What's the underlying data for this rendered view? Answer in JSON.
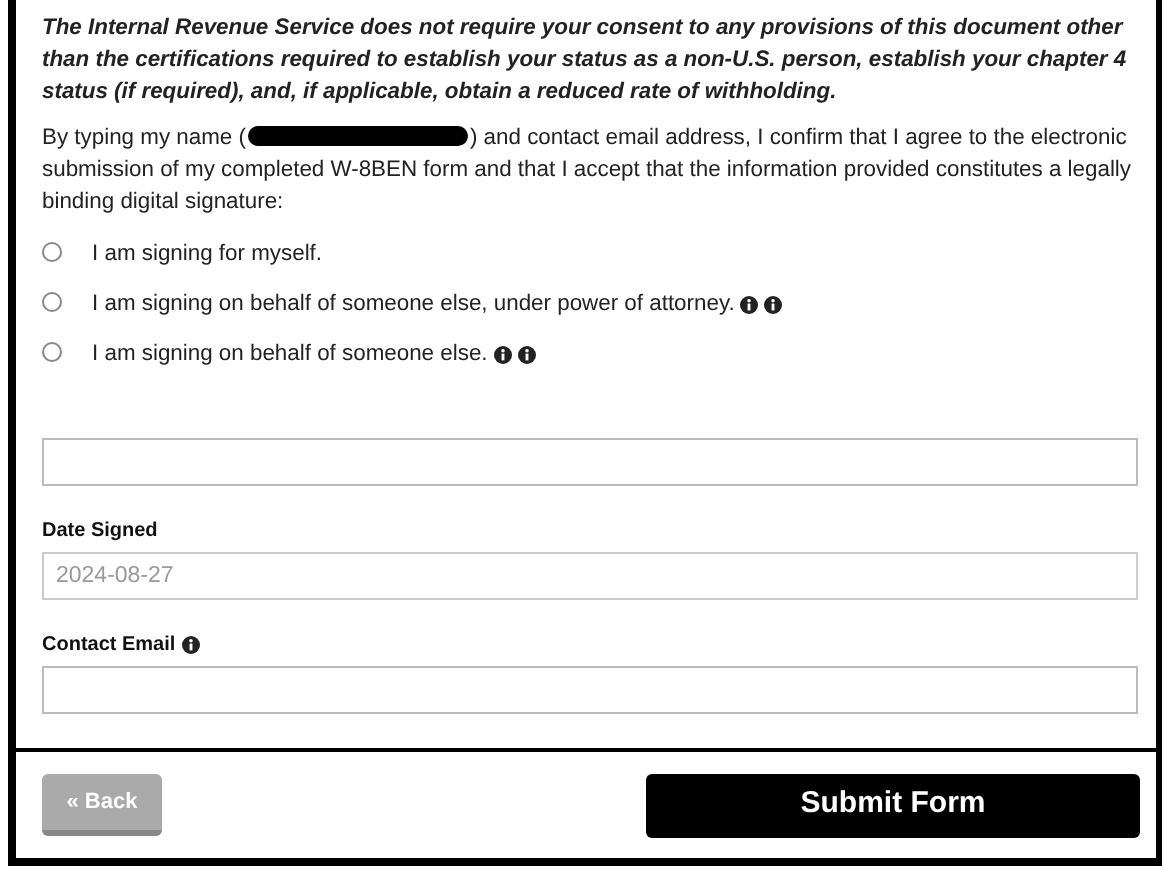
{
  "notice": "The Internal Revenue Service does not require your consent to any provisions of this document other than the certifications required to establish your status as a non-U.S. person, establish your chapter 4 status (if required), and, if applicable, obtain a reduced rate of withholding.",
  "consent": {
    "before": "By typing my name (",
    "redacted": true,
    "after": ") and contact email address, I confirm that I agree to the electronic submission of my completed W-8BEN form and that I accept that the information provided constitutes a legally binding digital signature:"
  },
  "options": [
    {
      "label": "I am signing for myself.",
      "selected": false,
      "kind": "plain"
    },
    {
      "label": "I am signing on behalf of someone else, under power of attorney.",
      "selected": false,
      "kind": "with_info"
    },
    {
      "label": "I am signing on behalf of someone else.",
      "selected": false,
      "kind": "with_info"
    }
  ],
  "fields": [
    {
      "kind": "signature"
    },
    {
      "kind": "labeled",
      "label": "Date Signed",
      "value": "2024-08-27",
      "disabled": true
    },
    {
      "kind": "labeled",
      "label": "Contact Email",
      "info": true
    }
  ],
  "back_button": {
    "label": "« Back",
    "disabled": true
  },
  "submit_button": {
    "label": "Submit Form"
  }
}
